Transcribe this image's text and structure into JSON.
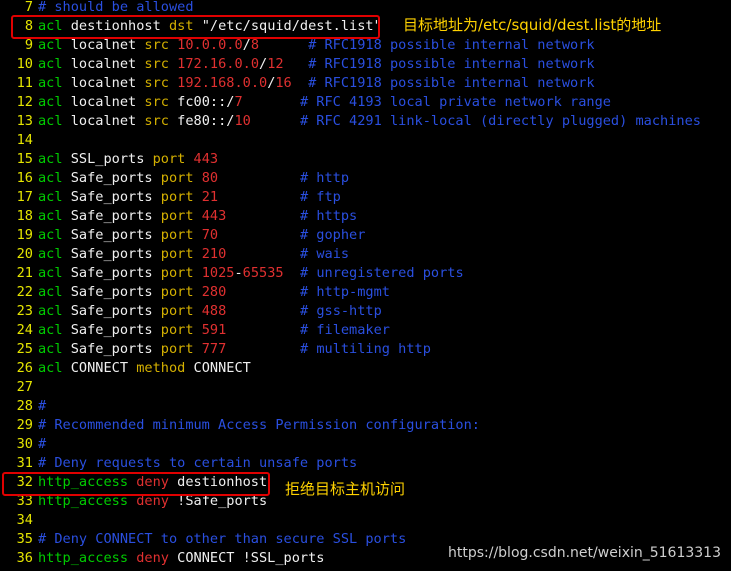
{
  "lines": [
    {
      "n": "7",
      "tokens": [
        {
          "t": "# should be allowed",
          "c": "cmt"
        }
      ]
    },
    {
      "n": "8",
      "tokens": [
        {
          "t": "acl",
          "c": "kw"
        },
        {
          "t": " destionhost ",
          "c": "plain"
        },
        {
          "t": "dst",
          "c": "type"
        },
        {
          "t": " \"/etc/squid/dest.list\"",
          "c": "str"
        }
      ]
    },
    {
      "n": "9",
      "tokens": [
        {
          "t": "acl",
          "c": "kw"
        },
        {
          "t": " localnet ",
          "c": "plain"
        },
        {
          "t": "src",
          "c": "type"
        },
        {
          "t": " ",
          "c": "plain"
        },
        {
          "t": "10.0.0.0",
          "c": "num"
        },
        {
          "t": "/",
          "c": "plain"
        },
        {
          "t": "8",
          "c": "num"
        },
        {
          "t": "      ",
          "c": "plain"
        },
        {
          "t": "# RFC1918 possible internal network",
          "c": "cmt"
        }
      ]
    },
    {
      "n": "10",
      "tokens": [
        {
          "t": "acl",
          "c": "kw"
        },
        {
          "t": " localnet ",
          "c": "plain"
        },
        {
          "t": "src",
          "c": "type"
        },
        {
          "t": " ",
          "c": "plain"
        },
        {
          "t": "172.16.0.0",
          "c": "num"
        },
        {
          "t": "/",
          "c": "plain"
        },
        {
          "t": "12",
          "c": "num"
        },
        {
          "t": "   ",
          "c": "plain"
        },
        {
          "t": "# RFC1918 possible internal network",
          "c": "cmt"
        }
      ]
    },
    {
      "n": "11",
      "tokens": [
        {
          "t": "acl",
          "c": "kw"
        },
        {
          "t": " localnet ",
          "c": "plain"
        },
        {
          "t": "src",
          "c": "type"
        },
        {
          "t": " ",
          "c": "plain"
        },
        {
          "t": "192.168.0.0",
          "c": "num"
        },
        {
          "t": "/",
          "c": "plain"
        },
        {
          "t": "16",
          "c": "num"
        },
        {
          "t": "  ",
          "c": "plain"
        },
        {
          "t": "# RFC1918 possible internal network",
          "c": "cmt"
        }
      ]
    },
    {
      "n": "12",
      "tokens": [
        {
          "t": "acl",
          "c": "kw"
        },
        {
          "t": " localnet ",
          "c": "plain"
        },
        {
          "t": "src",
          "c": "type"
        },
        {
          "t": " fc00::/",
          "c": "plain"
        },
        {
          "t": "7",
          "c": "num"
        },
        {
          "t": "       ",
          "c": "plain"
        },
        {
          "t": "# RFC 4193 local private network range",
          "c": "cmt"
        }
      ]
    },
    {
      "n": "13",
      "tokens": [
        {
          "t": "acl",
          "c": "kw"
        },
        {
          "t": " localnet ",
          "c": "plain"
        },
        {
          "t": "src",
          "c": "type"
        },
        {
          "t": " fe80::/",
          "c": "plain"
        },
        {
          "t": "10",
          "c": "num"
        },
        {
          "t": "      ",
          "c": "plain"
        },
        {
          "t": "# RFC 4291 link-local (directly plugged) machines",
          "c": "cmt"
        }
      ]
    },
    {
      "n": "14",
      "tokens": []
    },
    {
      "n": "15",
      "tokens": [
        {
          "t": "acl",
          "c": "kw"
        },
        {
          "t": " SSL_ports ",
          "c": "plain"
        },
        {
          "t": "port",
          "c": "type"
        },
        {
          "t": " ",
          "c": "plain"
        },
        {
          "t": "443",
          "c": "num"
        }
      ]
    },
    {
      "n": "16",
      "tokens": [
        {
          "t": "acl",
          "c": "kw"
        },
        {
          "t": " Safe_ports ",
          "c": "plain"
        },
        {
          "t": "port",
          "c": "type"
        },
        {
          "t": " ",
          "c": "plain"
        },
        {
          "t": "80",
          "c": "num"
        },
        {
          "t": "          ",
          "c": "plain"
        },
        {
          "t": "# http",
          "c": "cmt"
        }
      ]
    },
    {
      "n": "17",
      "tokens": [
        {
          "t": "acl",
          "c": "kw"
        },
        {
          "t": " Safe_ports ",
          "c": "plain"
        },
        {
          "t": "port",
          "c": "type"
        },
        {
          "t": " ",
          "c": "plain"
        },
        {
          "t": "21",
          "c": "num"
        },
        {
          "t": "          ",
          "c": "plain"
        },
        {
          "t": "# ftp",
          "c": "cmt"
        }
      ]
    },
    {
      "n": "18",
      "tokens": [
        {
          "t": "acl",
          "c": "kw"
        },
        {
          "t": " Safe_ports ",
          "c": "plain"
        },
        {
          "t": "port",
          "c": "type"
        },
        {
          "t": " ",
          "c": "plain"
        },
        {
          "t": "443",
          "c": "num"
        },
        {
          "t": "         ",
          "c": "plain"
        },
        {
          "t": "# https",
          "c": "cmt"
        }
      ]
    },
    {
      "n": "19",
      "tokens": [
        {
          "t": "acl",
          "c": "kw"
        },
        {
          "t": " Safe_ports ",
          "c": "plain"
        },
        {
          "t": "port",
          "c": "type"
        },
        {
          "t": " ",
          "c": "plain"
        },
        {
          "t": "70",
          "c": "num"
        },
        {
          "t": "          ",
          "c": "plain"
        },
        {
          "t": "# gopher",
          "c": "cmt"
        }
      ]
    },
    {
      "n": "20",
      "tokens": [
        {
          "t": "acl",
          "c": "kw"
        },
        {
          "t": " Safe_ports ",
          "c": "plain"
        },
        {
          "t": "port",
          "c": "type"
        },
        {
          "t": " ",
          "c": "plain"
        },
        {
          "t": "210",
          "c": "num"
        },
        {
          "t": "         ",
          "c": "plain"
        },
        {
          "t": "# wais",
          "c": "cmt"
        }
      ]
    },
    {
      "n": "21",
      "tokens": [
        {
          "t": "acl",
          "c": "kw"
        },
        {
          "t": " Safe_ports ",
          "c": "plain"
        },
        {
          "t": "port",
          "c": "type"
        },
        {
          "t": " ",
          "c": "plain"
        },
        {
          "t": "1025",
          "c": "num"
        },
        {
          "t": "-",
          "c": "plain"
        },
        {
          "t": "65535",
          "c": "num"
        },
        {
          "t": "  ",
          "c": "plain"
        },
        {
          "t": "# unregistered ports",
          "c": "cmt"
        }
      ]
    },
    {
      "n": "22",
      "tokens": [
        {
          "t": "acl",
          "c": "kw"
        },
        {
          "t": " Safe_ports ",
          "c": "plain"
        },
        {
          "t": "port",
          "c": "type"
        },
        {
          "t": " ",
          "c": "plain"
        },
        {
          "t": "280",
          "c": "num"
        },
        {
          "t": "         ",
          "c": "plain"
        },
        {
          "t": "# http-mgmt",
          "c": "cmt"
        }
      ]
    },
    {
      "n": "23",
      "tokens": [
        {
          "t": "acl",
          "c": "kw"
        },
        {
          "t": " Safe_ports ",
          "c": "plain"
        },
        {
          "t": "port",
          "c": "type"
        },
        {
          "t": " ",
          "c": "plain"
        },
        {
          "t": "488",
          "c": "num"
        },
        {
          "t": "         ",
          "c": "plain"
        },
        {
          "t": "# gss-http",
          "c": "cmt"
        }
      ]
    },
    {
      "n": "24",
      "tokens": [
        {
          "t": "acl",
          "c": "kw"
        },
        {
          "t": " Safe_ports ",
          "c": "plain"
        },
        {
          "t": "port",
          "c": "type"
        },
        {
          "t": " ",
          "c": "plain"
        },
        {
          "t": "591",
          "c": "num"
        },
        {
          "t": "         ",
          "c": "plain"
        },
        {
          "t": "# filemaker",
          "c": "cmt"
        }
      ]
    },
    {
      "n": "25",
      "tokens": [
        {
          "t": "acl",
          "c": "kw"
        },
        {
          "t": " Safe_ports ",
          "c": "plain"
        },
        {
          "t": "port",
          "c": "type"
        },
        {
          "t": " ",
          "c": "plain"
        },
        {
          "t": "777",
          "c": "num"
        },
        {
          "t": "         ",
          "c": "plain"
        },
        {
          "t": "# multiling http",
          "c": "cmt"
        }
      ]
    },
    {
      "n": "26",
      "tokens": [
        {
          "t": "acl",
          "c": "kw"
        },
        {
          "t": " CONNECT ",
          "c": "plain"
        },
        {
          "t": "method",
          "c": "type"
        },
        {
          "t": " CONNECT",
          "c": "plain"
        }
      ]
    },
    {
      "n": "27",
      "tokens": []
    },
    {
      "n": "28",
      "tokens": [
        {
          "t": "#",
          "c": "cmt"
        }
      ]
    },
    {
      "n": "29",
      "tokens": [
        {
          "t": "# Recommended minimum Access Permission configuration:",
          "c": "cmt"
        }
      ]
    },
    {
      "n": "30",
      "tokens": [
        {
          "t": "#",
          "c": "cmt"
        }
      ]
    },
    {
      "n": "31",
      "tokens": [
        {
          "t": "# Deny requests to certain unsafe ports",
          "c": "cmt"
        }
      ]
    },
    {
      "n": "32",
      "tokens": [
        {
          "t": "http_access",
          "c": "kw"
        },
        {
          "t": " ",
          "c": "plain"
        },
        {
          "t": "deny",
          "c": "num"
        },
        {
          "t": " destionhost",
          "c": "plain"
        }
      ]
    },
    {
      "n": "33",
      "tokens": [
        {
          "t": "http_access",
          "c": "kw"
        },
        {
          "t": " ",
          "c": "plain"
        },
        {
          "t": "deny",
          "c": "num"
        },
        {
          "t": " !Safe_ports",
          "c": "plain"
        }
      ]
    },
    {
      "n": "34",
      "tokens": []
    },
    {
      "n": "35",
      "tokens": [
        {
          "t": "# Deny CONNECT to other than secure SSL ports",
          "c": "cmt"
        }
      ]
    },
    {
      "n": "36",
      "tokens": [
        {
          "t": "http_access",
          "c": "kw"
        },
        {
          "t": " ",
          "c": "plain"
        },
        {
          "t": "deny",
          "c": "num"
        },
        {
          "t": " CONNECT !SSL_ports",
          "c": "plain"
        }
      ]
    }
  ],
  "annotations": {
    "dest_note": "目标地址为/etc/squid/dest.list的地址",
    "deny_note": "拒绝目标主机访问"
  },
  "watermark": "https://blog.csdn.net/weixin_51613313",
  "colors": {
    "background": "#000000",
    "line_number": "#e6e600",
    "keyword": "#00cc00",
    "type": "#d4b000",
    "number": "#e03030",
    "comment": "#2a4fe0",
    "highlight_box": "#e00000",
    "annotation_text": "#ffd200"
  }
}
